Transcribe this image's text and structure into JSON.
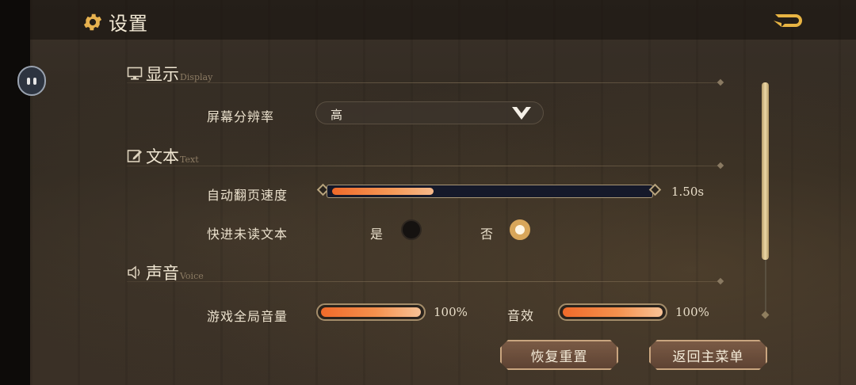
{
  "header": {
    "title": "设置"
  },
  "display": {
    "heading": "显示",
    "heading_en": "Display",
    "resolution_label": "屏幕分辨率",
    "resolution_value": "高"
  },
  "text": {
    "heading": "文本",
    "heading_en": "Text",
    "auto_page_label": "自动翻页速度",
    "auto_page_value": "1.50s",
    "auto_page_fraction": 0.32,
    "fast_forward_label": "快进未读文本",
    "yes_label": "是",
    "no_label": "否",
    "fast_forward_selected": "否"
  },
  "voice": {
    "heading": "声音",
    "heading_en": "Voice",
    "master_label": "游戏全局音量",
    "master_value": "100%",
    "master_fraction": 1.0,
    "sfx_label": "音效",
    "sfx_value": "100%",
    "sfx_fraction": 1.0
  },
  "footer": {
    "reset_label": "恢复重置",
    "main_menu_label": "返回主菜单"
  },
  "colors": {
    "accent": "#f28a45",
    "gold": "#d8a65a",
    "button_bg": "#6b4d3b"
  },
  "icons": {
    "title": "gear-icon",
    "back": "back-arrow-icon",
    "display": "monitor-icon",
    "text": "edit-icon",
    "voice": "speaker-icon",
    "dropdown": "chevron-down-icon"
  }
}
